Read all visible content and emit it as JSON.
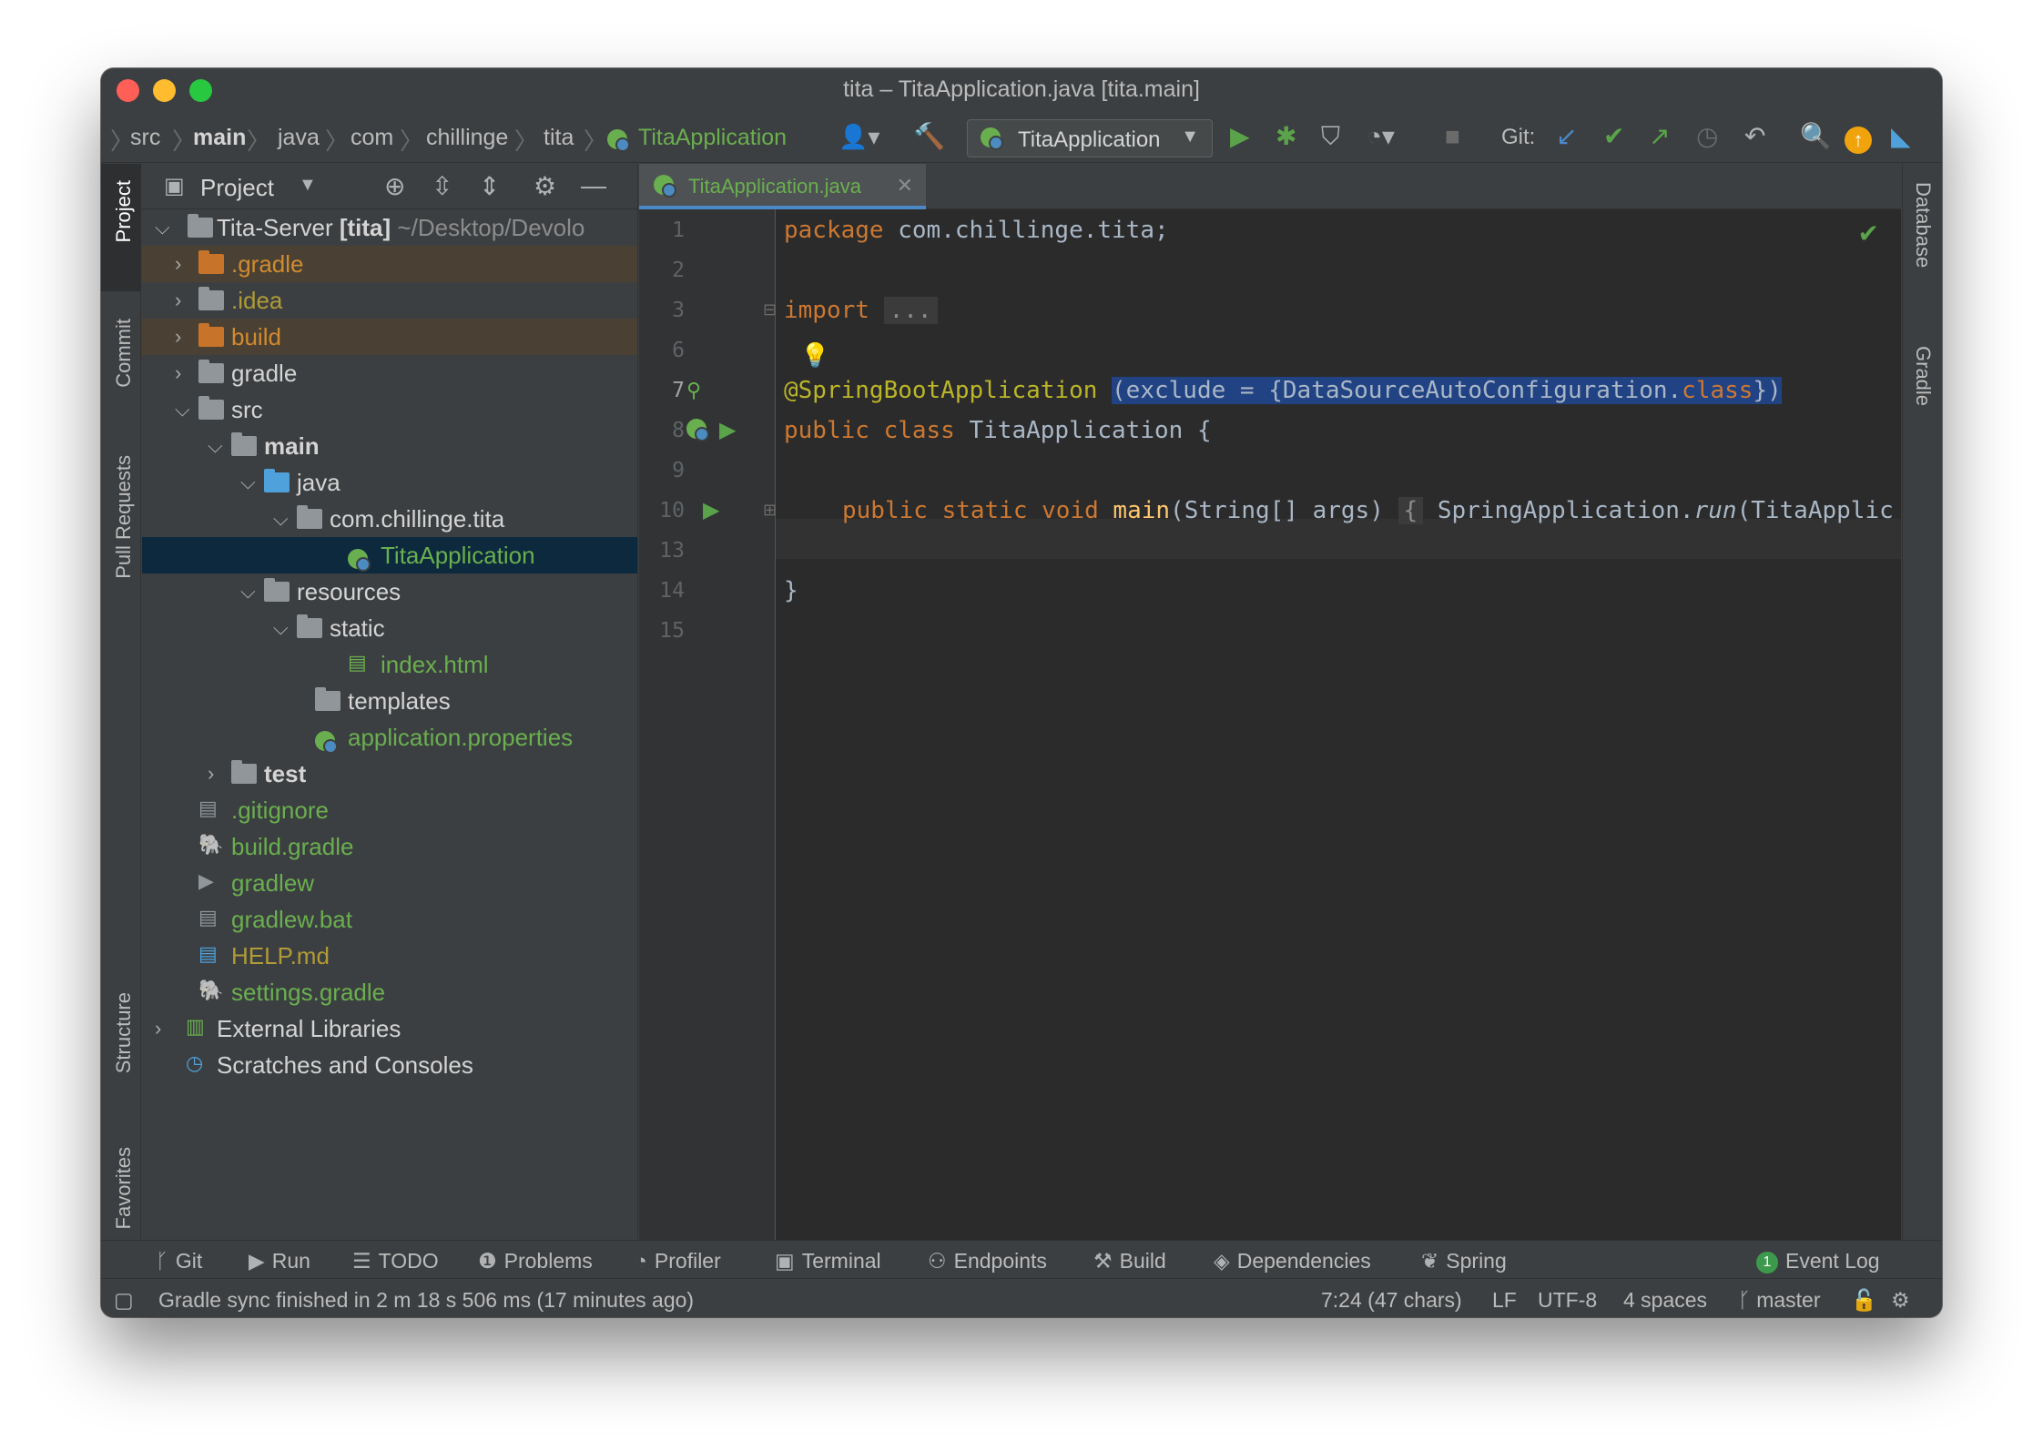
{
  "window": {
    "title": "tita – TitaApplication.java [tita.main]"
  },
  "breadcrumb": [
    "src",
    "main",
    "java",
    "com",
    "chillinge",
    "tita",
    "TitaApplication"
  ],
  "toolbar": {
    "run_config": "TitaApplication",
    "git_label": "Git:"
  },
  "left_strip": {
    "project": "Project",
    "commit": "Commit",
    "pull_requests": "Pull Requests",
    "structure": "Structure",
    "favorites": "Favorites"
  },
  "right_strip": {
    "database": "Database",
    "gradle": "Gradle"
  },
  "project_panel": {
    "title": "Project",
    "tree": [
      {
        "label": "Tita-Server",
        "suffix": "[tita]",
        "path": "~/Desktop/Devolo"
      },
      {
        "label": ".gradle"
      },
      {
        "label": ".idea"
      },
      {
        "label": "build"
      },
      {
        "label": "gradle"
      },
      {
        "label": "src"
      },
      {
        "label": "main"
      },
      {
        "label": "java"
      },
      {
        "label": "com.chillinge.tita"
      },
      {
        "label": "TitaApplication"
      },
      {
        "label": "resources"
      },
      {
        "label": "static"
      },
      {
        "label": "index.html"
      },
      {
        "label": "templates"
      },
      {
        "label": "application.properties"
      },
      {
        "label": "test"
      },
      {
        "label": ".gitignore"
      },
      {
        "label": "build.gradle"
      },
      {
        "label": "gradlew"
      },
      {
        "label": "gradlew.bat"
      },
      {
        "label": "HELP.md"
      },
      {
        "label": "settings.gradle"
      },
      {
        "label": "External Libraries"
      },
      {
        "label": "Scratches and Consoles"
      }
    ]
  },
  "editor": {
    "tab_label": "TitaApplication.java",
    "line_numbers": [
      "1",
      "2",
      "3",
      "6",
      "7",
      "8",
      "9",
      "10",
      "13",
      "14",
      "15"
    ],
    "code": {
      "l1_kw": "package",
      "l1_rest": " com.chillinge.tita;",
      "l3_kw": "import",
      "l3_fold": "...",
      "l7_ann": "@SpringBootApplication",
      "l7_sel_a": "(exclude = {DataSourceAutoConfiguration.",
      "l7_sel_kw": "class",
      "l7_sel_b": "})",
      "l8_kw": "public class",
      "l8_rest": " TitaApplication {",
      "l10_kw": "public static void",
      "l10_fn": "main",
      "l10_args": "(String[] args)",
      "l10_brace": "{",
      "l10_body_a": "SpringApplication.",
      "l10_body_run": "run",
      "l10_body_b": "(TitaApplic",
      "l14": "}"
    }
  },
  "tool_windows": [
    "Git",
    "Run",
    "TODO",
    "Problems",
    "Profiler",
    "Terminal",
    "Endpoints",
    "Build",
    "Dependencies",
    "Spring"
  ],
  "event_log": {
    "count": "1",
    "label": "Event Log"
  },
  "status_bar": {
    "message": "Gradle sync finished in 2 m 18 s 506 ms (17 minutes ago)",
    "position": "7:24 (47 chars)",
    "line_sep": "LF",
    "encoding": "UTF-8",
    "indent": "4 spaces",
    "branch": "master"
  }
}
